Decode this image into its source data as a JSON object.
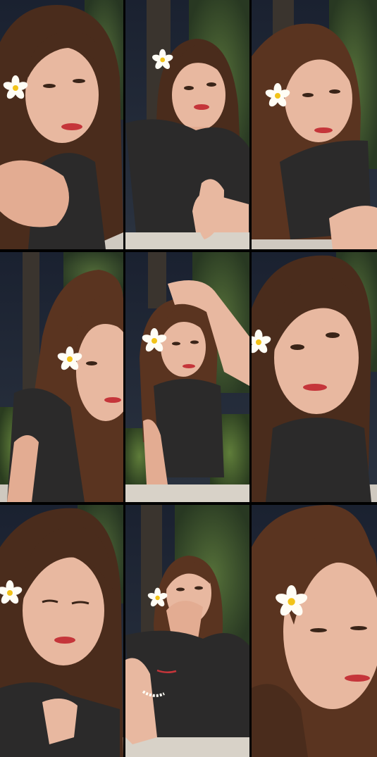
{
  "collage": {
    "layout": "3x3 grid",
    "tiles": [
      {
        "subject": "girl-with-flower",
        "flower": "white-frangipani",
        "pose": "hand-near-face"
      },
      {
        "subject": "girl-with-flower",
        "flower": "white-frangipani",
        "pose": "waving"
      },
      {
        "subject": "girl-with-flower",
        "flower": "white-frangipani",
        "pose": "reaching"
      },
      {
        "subject": "girl-with-flower",
        "flower": "white-frangipani",
        "pose": "leaning-side"
      },
      {
        "subject": "girl-with-flower",
        "flower": "white-frangipani",
        "pose": "hand-on-head"
      },
      {
        "subject": "girl-with-flower",
        "flower": "white-frangipani",
        "pose": "close-up"
      },
      {
        "subject": "girl-with-flower",
        "flower": "white-frangipani",
        "pose": "looking-down"
      },
      {
        "subject": "girl-with-flower",
        "flower": "white-frangipani",
        "pose": "hand-over-mouth"
      },
      {
        "subject": "girl-with-flower",
        "flower": "white-frangipani",
        "pose": "extreme-close-up"
      }
    ]
  },
  "colors": {
    "frame": "#000000",
    "night_sky": "#1d2433",
    "foliage": "#3e5a2a",
    "hair": "#4a2c1c",
    "skin": "#e8b8a0",
    "shirt": "#2b2a2a",
    "flower_petal": "#fffdf5",
    "flower_center": "#f2c318"
  }
}
